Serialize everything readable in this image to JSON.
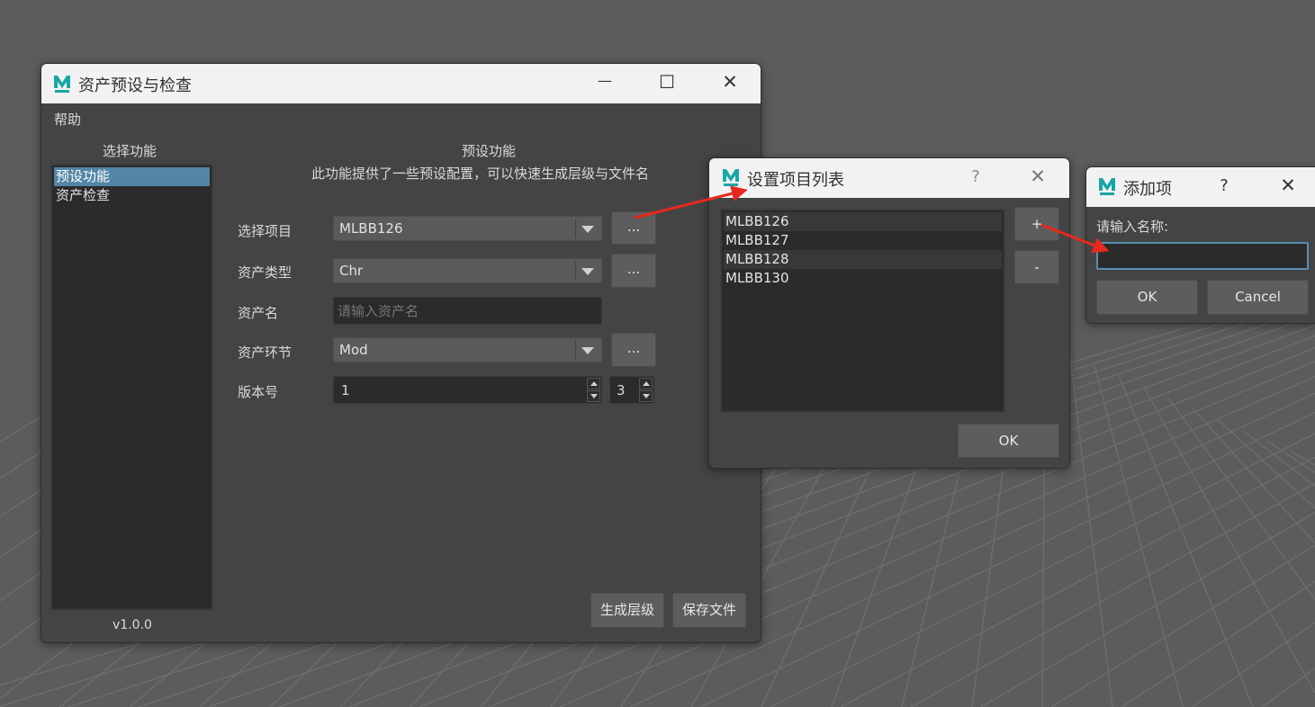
{
  "colors": {
    "viewport_bg": "#5c5c5c",
    "window_bg": "#444444",
    "titlebar_bg": "#f2f2f2",
    "selection": "#5285a6",
    "arrow_red": "#e8281e",
    "logo_teal": "#1aa6a6"
  },
  "main_window": {
    "title": "资产预设与检查",
    "minimize_glyph": "—",
    "maximize_glyph": "☐",
    "close_glyph": "✕",
    "menu": {
      "help": "帮助"
    },
    "left_panel": {
      "heading": "选择功能",
      "items": [
        "预设功能",
        "资产检查"
      ],
      "selected_index": 0,
      "version": "v1.0.0"
    },
    "right_panel": {
      "heading": "预设功能",
      "description": "此功能提供了一些预设配置，可以快速生成层级与文件名",
      "project": {
        "label": "选择项目",
        "value": "MLBB126",
        "button": "..."
      },
      "asset_type": {
        "label": "资产类型",
        "value": "Chr",
        "button": "..."
      },
      "asset_name": {
        "label": "资产名",
        "placeholder": "请输入资产名",
        "value": ""
      },
      "asset_stage": {
        "label": "资产环节",
        "value": "Mod",
        "button": "..."
      },
      "version": {
        "label": "版本号",
        "value": "1",
        "padding": "3"
      },
      "generate_button": "生成层级",
      "save_button": "保存文件"
    }
  },
  "project_list_dialog": {
    "title": "设置项目列表",
    "help_glyph": "?",
    "close_glyph": "✕",
    "items": [
      "MLBB126",
      "MLBB127",
      "MLBB128",
      "MLBB130"
    ],
    "add_button": "+",
    "remove_button": "-",
    "ok_button": "OK"
  },
  "add_item_dialog": {
    "title": "添加项",
    "help_glyph": "?",
    "close_glyph": "✕",
    "prompt": "请输入名称:",
    "input_value": "",
    "ok_button": "OK",
    "cancel_button": "Cancel"
  },
  "icons": {
    "app_logo": "maya-logo-icon",
    "annotation": "red-arrow-icon"
  }
}
